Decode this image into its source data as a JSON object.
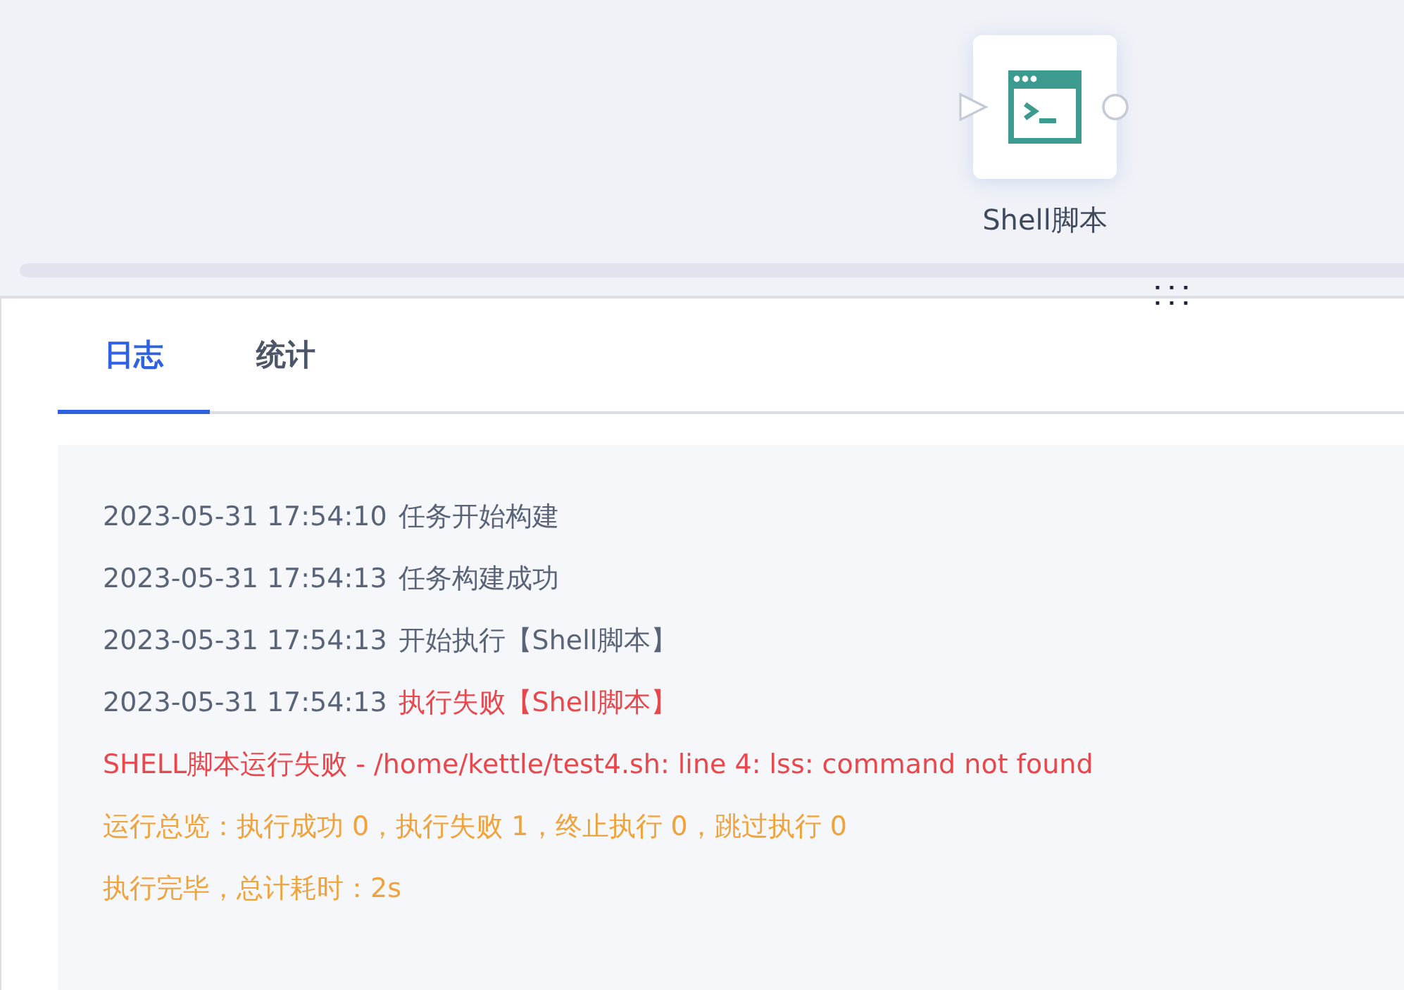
{
  "canvas": {
    "node": {
      "label": "Shell脚本"
    }
  },
  "tabs": [
    {
      "label": "日志",
      "selected": true
    },
    {
      "label": "统计",
      "selected": false
    }
  ],
  "log": [
    {
      "time": "2023-05-31 17:54:10",
      "text": "任务开始构建",
      "kind": "info"
    },
    {
      "time": "2023-05-31 17:54:13",
      "text": "任务构建成功",
      "kind": "info"
    },
    {
      "time": "2023-05-31 17:54:13",
      "text": "开始执行【Shell脚本】",
      "kind": "info"
    },
    {
      "time": "2023-05-31 17:54:13",
      "text": "执行失败【Shell脚本】",
      "kind": "error"
    },
    {
      "text": "SHELL脚本运行失败 - /home/kettle/test4.sh: line 4: lss: command not found",
      "kind": "error"
    },
    {
      "text": "运行总览：执行成功 0，执行失败 1，终止执行 0，跳过执行 0",
      "kind": "warning"
    },
    {
      "text": "执行完毕，总计耗时：2s",
      "kind": "warning"
    }
  ]
}
